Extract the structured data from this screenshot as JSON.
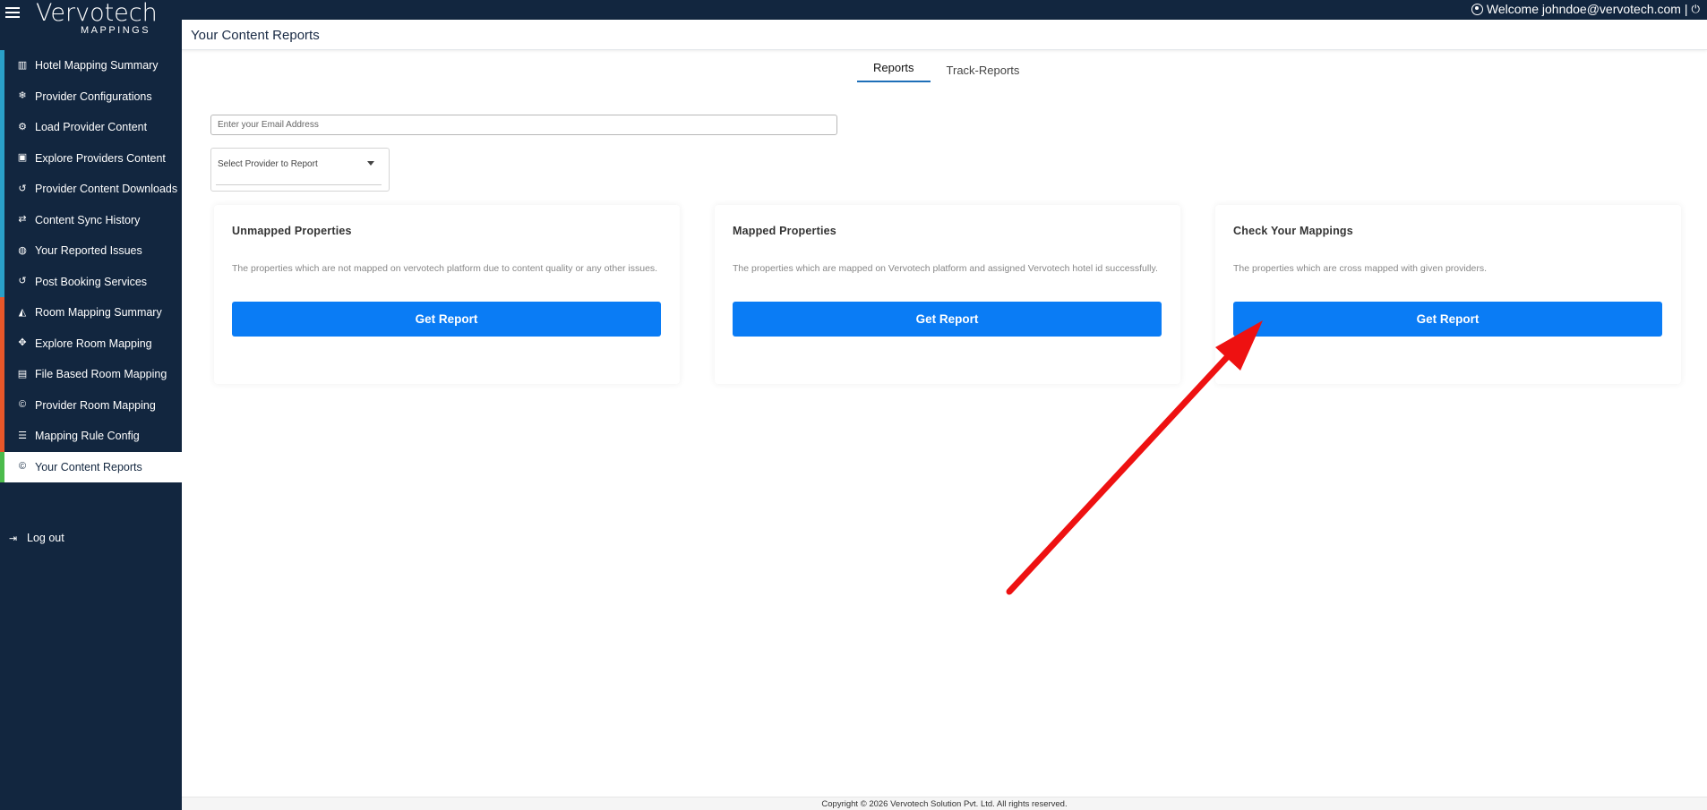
{
  "app": {
    "logo_main": "Vervotech",
    "logo_sub": "MAPPINGS",
    "welcome": "Welcome johndoe@vervotech.com |"
  },
  "sidebar": {
    "items": [
      {
        "label": "Hotel Mapping Summary",
        "icon": "bar-chart-icon",
        "glyph": "▥",
        "accent": "#2aa0c8"
      },
      {
        "label": "Provider Configurations",
        "icon": "snowflake-icon",
        "glyph": "❄",
        "accent": "#2aa0c8"
      },
      {
        "label": "Load Provider Content",
        "icon": "cogs-icon",
        "glyph": "⚙",
        "accent": "#2aa0c8"
      },
      {
        "label": "Explore Providers Content",
        "icon": "save-icon",
        "glyph": "▣",
        "accent": "#2aa0c8"
      },
      {
        "label": "Provider Content Downloads",
        "icon": "history-icon",
        "glyph": "↺",
        "accent": "#2aa0c8"
      },
      {
        "label": "Content Sync History",
        "icon": "sync-icon",
        "glyph": "⇄",
        "accent": "#2aa0c8"
      },
      {
        "label": "Your Reported Issues",
        "icon": "globe-icon",
        "glyph": "◍",
        "accent": "#2aa0c8"
      },
      {
        "label": "Post Booking Services",
        "icon": "history-icon",
        "glyph": "↺",
        "accent": "#2aa0c8"
      },
      {
        "label": "Room Mapping Summary",
        "icon": "area-chart-icon",
        "glyph": "◭",
        "accent": "#e8572a"
      },
      {
        "label": "Explore Room Mapping",
        "icon": "move-icon",
        "glyph": "✥",
        "accent": "#e8572a"
      },
      {
        "label": "File Based Room Mapping",
        "icon": "file-icon",
        "glyph": "▤",
        "accent": "#e8572a"
      },
      {
        "label": "Provider Room Mapping",
        "icon": "copyright-icon",
        "glyph": "©",
        "accent": "#e8572a"
      },
      {
        "label": "Mapping Rule Config",
        "icon": "sliders-icon",
        "glyph": "☰",
        "accent": "#e8572a"
      },
      {
        "label": "Your Content Reports",
        "icon": "copyright-icon",
        "glyph": "©",
        "accent": "#4cbb4c",
        "active": true
      }
    ],
    "logout": "Log out"
  },
  "header": {
    "title": "Your Content Reports"
  },
  "tabs": [
    "Reports",
    "Track-Reports"
  ],
  "form": {
    "email_placeholder": "Enter your Email Address",
    "provider_placeholder": "Select Provider to Report"
  },
  "cards": [
    {
      "title": "Unmapped Properties",
      "desc": "The properties which are not mapped on vervotech platform due to content quality or any other issues.",
      "button": "Get Report"
    },
    {
      "title": "Mapped Properties",
      "desc": "The properties which are mapped on Vervotech platform and assigned Vervotech hotel id successfully.",
      "button": "Get Report"
    },
    {
      "title": "Check Your Mappings",
      "desc": "The properties which are cross mapped with given providers.",
      "button": "Get Report"
    }
  ],
  "footer": "Copyright © 2026 Vervotech Solution Pvt. Ltd. All rights reserved.",
  "colors": {
    "sidebar_bg": "#12263f",
    "primary_button": "#0a7cf5",
    "annotation_arrow": "#ee1111"
  }
}
